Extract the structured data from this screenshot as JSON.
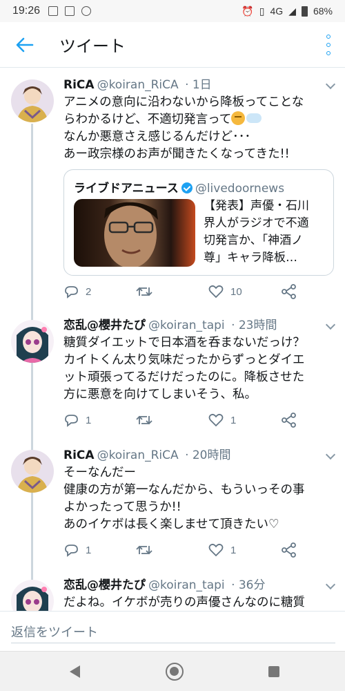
{
  "status_bar": {
    "time": "19:26",
    "network": "4G",
    "battery": "68%"
  },
  "header": {
    "title": "ツイート"
  },
  "tweets": [
    {
      "name": "RiCA",
      "handle": "@koiran_RiCA",
      "time": "· 1日",
      "lines": [
        "アニメの意向に沿わないから降板ってことな",
        "らわかるけど、不適切発言って",
        "なんか悪意さえ感じるんだけど･･･",
        "あー政宗様のお声が聞きたくなってきた!!"
      ],
      "quote": {
        "name": "ライブドアニュース",
        "handle": "@livedoornews",
        "lines": [
          "【発表】声優・石川",
          "界人がラジオで不適",
          "切発言か、「神酒ノ",
          "尊」キャラ降板…"
        ]
      },
      "replies": "2",
      "retweets": "",
      "likes": "10"
    },
    {
      "name": "恋乱@櫻井たぴ",
      "handle": "@koiran_tapi",
      "time": "· 23時間",
      "lines": [
        "糖質ダイエットで日本酒を呑まないだっけ？",
        "カイトくん太り気味だったからずっとダイエ",
        "ット頑張ってるだけだったのに。降板させた",
        "方に悪意を向けてしまいそう、私。"
      ],
      "replies": "1",
      "retweets": "",
      "likes": "1"
    },
    {
      "name": "RiCA",
      "handle": "@koiran_RiCA",
      "time": "· 20時間",
      "lines": [
        "そーなんだー",
        "健康の方が第一なんだから、もういっその事",
        "よかったって思うか!!",
        "あのイケボは長く楽しませて頂きたい♡"
      ],
      "replies": "1",
      "retweets": "",
      "likes": "1"
    },
    {
      "name": "恋乱@櫻井たぴ",
      "handle": "@koiran_tapi",
      "time": "· 36分",
      "lines": [
        "だよね。イケボが売りの声優さんなのに糖質"
      ]
    }
  ],
  "reply_bar": {
    "placeholder": "返信をツイート"
  }
}
